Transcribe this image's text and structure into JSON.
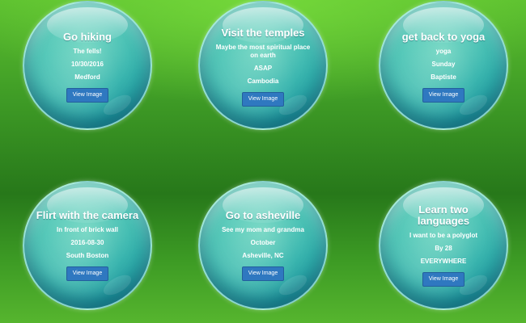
{
  "bubbles": [
    {
      "title": "Go hiking",
      "lines": [
        "The fells!",
        "10/30/2016",
        "Medford"
      ],
      "button_label": "View Image"
    },
    {
      "title": "Visit the temples",
      "lines": [
        "Maybe the most spiritual place on earth",
        "ASAP",
        "Cambodia"
      ],
      "button_label": "View Image"
    },
    {
      "title": "get back to yoga",
      "lines": [
        "yoga",
        "Sunday",
        "Baptiste"
      ],
      "button_label": "View Image"
    },
    {
      "title": "Flirt with the camera",
      "lines": [
        "In front of brick wall",
        "2016-08-30",
        "South Boston"
      ],
      "button_label": "View Image"
    },
    {
      "title": "Go to asheville",
      "lines": [
        "See my mom and grandma",
        "October",
        "Asheville, NC"
      ],
      "button_label": "View Image"
    },
    {
      "title": "Learn two languages",
      "lines": [
        "I want to be a polyglot",
        "By 28",
        "EVERYWHERE"
      ],
      "button_label": "View Image"
    }
  ]
}
